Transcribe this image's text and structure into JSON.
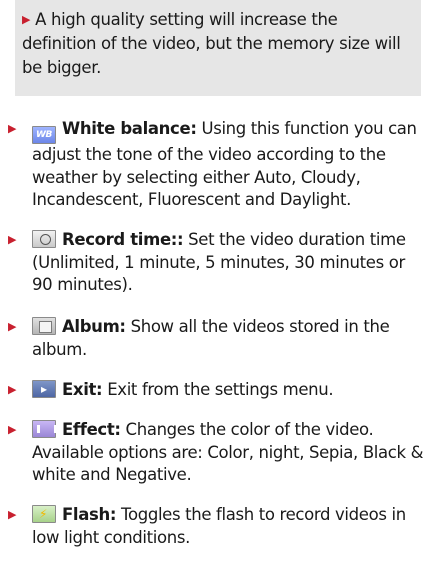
{
  "note": {
    "text": "A high quality setting will increase the definition of the video, but the memory size will be bigger."
  },
  "items": [
    {
      "icon": "white-balance-icon",
      "icon_text": "WB",
      "title": "White balance:",
      "text": " Using this function you can adjust the tone of the video according to the weather by selecting either Auto, Cloudy, Incandescent, Fluorescent and Daylight."
    },
    {
      "icon": "record-time-icon",
      "title": "Record time::",
      "text": " Set the video duration time (Unlimited, 1 minute, 5 minutes, 30 minutes or 90 minutes)."
    },
    {
      "icon": "album-icon",
      "title": "Album:",
      "text": " Show all the videos stored in the album."
    },
    {
      "icon": "exit-icon",
      "title": "Exit:",
      "text": " Exit from the settings menu."
    },
    {
      "icon": "effect-icon",
      "title": "Effect:",
      "text": " Changes the color of the video. Available options are: Color, night, Sepia, Black & white and Negative."
    },
    {
      "icon": "flash-icon",
      "title": "Flash:",
      "text": " Toggles the flash to record videos in low light conditions."
    }
  ],
  "colors": {
    "bullet": "#c8202f",
    "note_bg": "#e6e6e6"
  }
}
